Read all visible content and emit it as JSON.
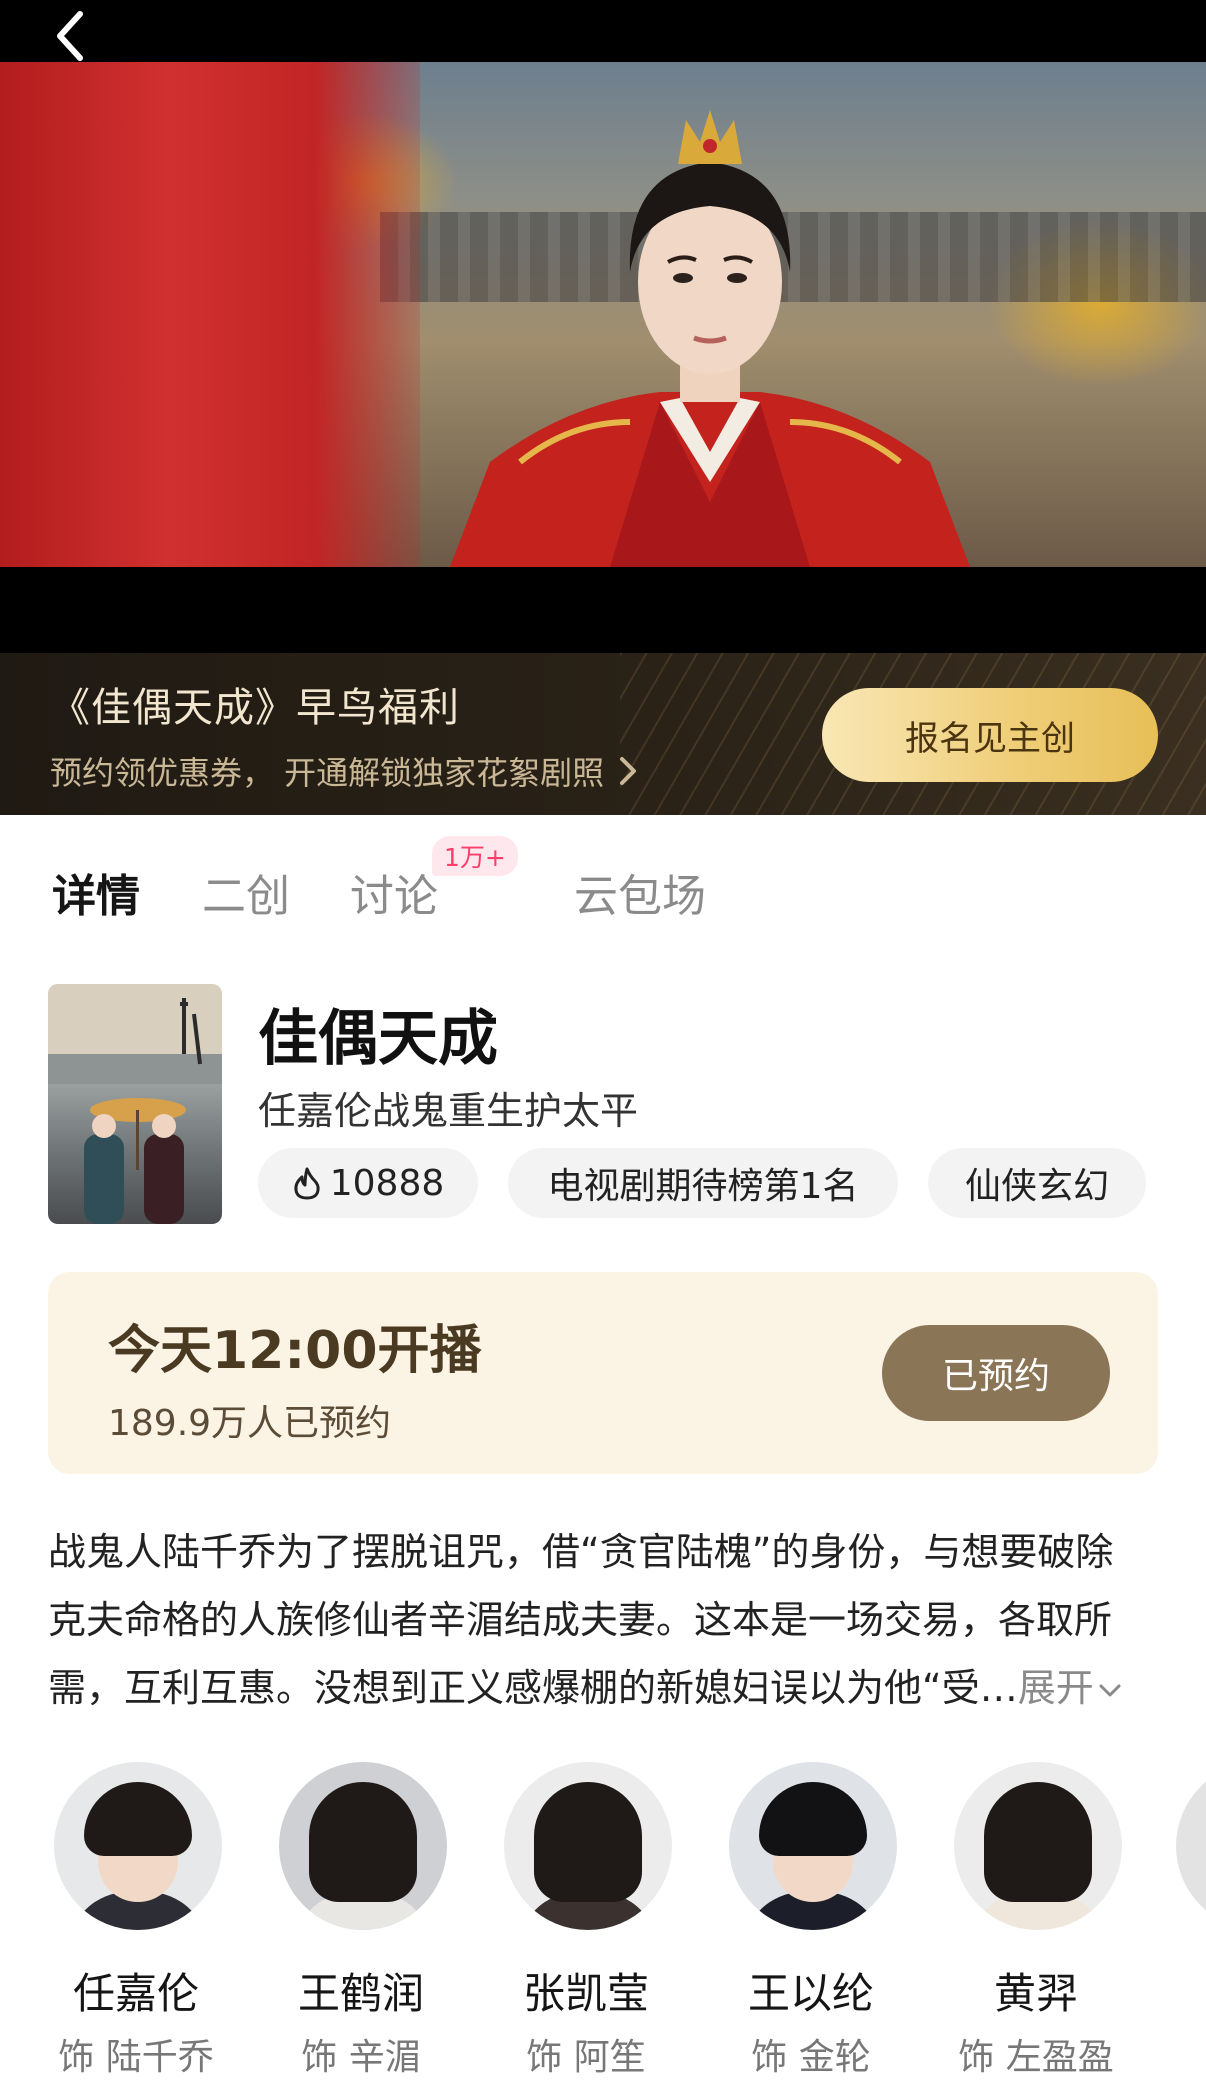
{
  "banner": {
    "title": "《佳偶天成》早鸟福利",
    "subtitle": "预约领优惠券， 开通解锁独家花絮剧照",
    "button_label": "报名见主创"
  },
  "tabs": [
    {
      "label": "详情",
      "active": true
    },
    {
      "label": "二创",
      "active": false
    },
    {
      "label": "讨论",
      "active": false,
      "badge": "1万+"
    },
    {
      "label": "云包场",
      "active": false
    }
  ],
  "show": {
    "title": "佳偶天成",
    "subtitle": "任嘉伦战鬼重生护太平",
    "chips": {
      "heat": "10888",
      "rank": "电视剧期待榜第1名",
      "genre": "仙侠玄幻"
    }
  },
  "schedule": {
    "time_text": "今天12:00开播",
    "reservations": "189.9万人已预约",
    "button_label": "已预约"
  },
  "synopsis": {
    "lines": [
      "战鬼人陆千乔为了摆脱诅咒，借“贪官陆槐”的身份，与想要破除",
      "克夫命格的人族修仙者辛湄结成夫妻。这本是一场交易，各取所",
      "需，互利互惠。没想到正义感爆棚的新媳妇误以为他“受…"
    ],
    "expand_label": "展开"
  },
  "cast": [
    {
      "name": "任嘉伦",
      "role": "饰 陆千乔"
    },
    {
      "name": "王鹤润",
      "role": "饰 辛湄"
    },
    {
      "name": "张凯莹",
      "role": "饰 阿笙"
    },
    {
      "name": "王以纶",
      "role": "饰 金轮"
    },
    {
      "name": "黄羿",
      "role": "饰 左盈盈"
    }
  ],
  "colors": {
    "banner_bg": "#2a2217",
    "banner_button": "#f0cf7b",
    "schedule_bg": "#fbf3e4",
    "reserved_button": "#8b7557",
    "badge": "#ff3d6a"
  }
}
